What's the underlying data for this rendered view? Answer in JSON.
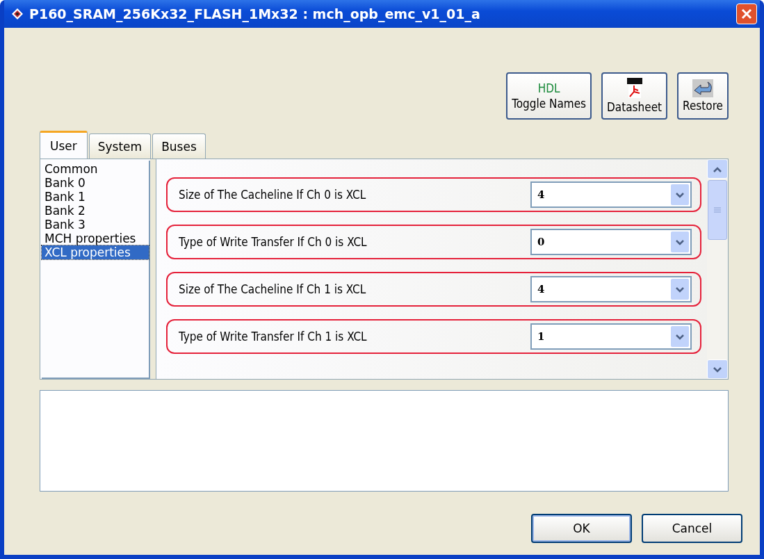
{
  "window": {
    "title": "P160_SRAM_256Kx32_FLASH_1Mx32 : mch_opb_emc_v1_01_a"
  },
  "toolbar": [
    {
      "kind": "hdl",
      "badge": "HDL",
      "label": "Toggle Names"
    },
    {
      "kind": "pdf",
      "label": "Datasheet"
    },
    {
      "kind": "restore",
      "label": "Restore"
    }
  ],
  "tabs": [
    {
      "label": "User",
      "selected": true
    },
    {
      "label": "System",
      "selected": false
    },
    {
      "label": "Buses",
      "selected": false
    }
  ],
  "categories": [
    {
      "label": "Common",
      "selected": false
    },
    {
      "label": "Bank 0",
      "selected": false
    },
    {
      "label": "Bank 1",
      "selected": false
    },
    {
      "label": "Bank 2",
      "selected": false
    },
    {
      "label": "Bank 3",
      "selected": false
    },
    {
      "label": "MCH properties",
      "selected": false
    },
    {
      "label": "XCL properties",
      "selected": true
    }
  ],
  "parameters": [
    {
      "label": "Size of The Cacheline If Ch 0 is XCL",
      "value": "4"
    },
    {
      "label": "Type of Write Transfer If Ch 0 is XCL",
      "value": "0"
    },
    {
      "label": "Size of The Cacheline If Ch 1 is XCL",
      "value": "4"
    },
    {
      "label": "Type of Write Transfer If Ch 1 is XCL",
      "value": "1"
    }
  ],
  "buttons": [
    "OK",
    "Cancel"
  ]
}
